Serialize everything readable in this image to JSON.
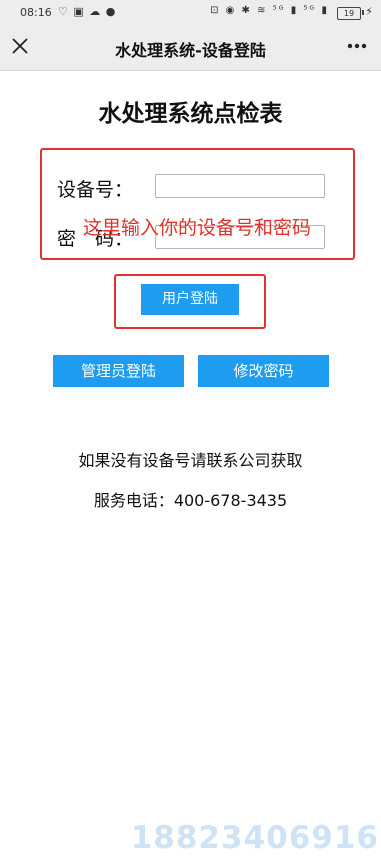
{
  "status_bar": {
    "time": "08:16",
    "left_icons": "♡ ▣ ☁ ●",
    "right_icons": "⊡ ◉ ✱ ≋ ⁵ᴳ ▮ ⁵ᴳ ▮",
    "battery": "19"
  },
  "nav": {
    "title": "水处理系统-设备登陆"
  },
  "page": {
    "title": "水处理系统点检表",
    "device_label": "设备号：",
    "password_label": "密　码：",
    "annotation": "这里输入你的设备号和密码",
    "login_button": "用户登陆",
    "admin_button": "管理员登陆",
    "change_password_button": "修改密码",
    "info_line_1": "如果没有设备号请联系公司获取",
    "info_line_2": "服务电话：400-678-3435"
  },
  "inputs": {
    "device_value": "",
    "password_value": ""
  },
  "watermark": "18823406916",
  "colors": {
    "accent_blue": "#1e9cf0",
    "annotation_red": "#e0332e",
    "bar_gray": "#ededed"
  }
}
